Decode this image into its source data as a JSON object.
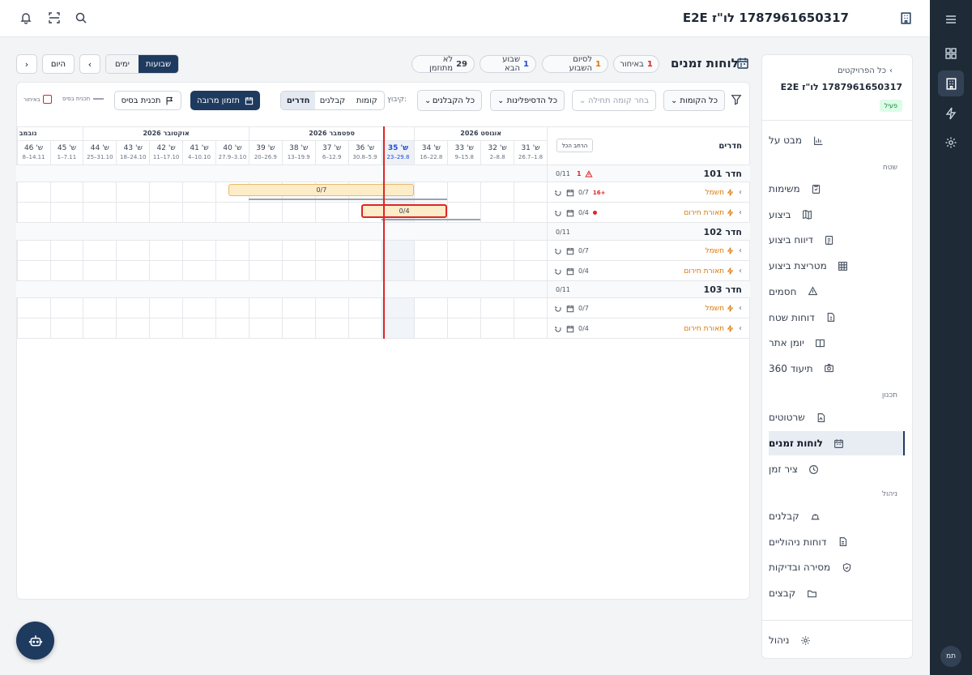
{
  "header": {
    "project_title": "1787961650317 לו\"ז E2E"
  },
  "rail": {
    "avatar": "תמ"
  },
  "sidebar": {
    "back_label": "כל הפרויקטים",
    "project_name": "1787961650317 לו\"ז E2E",
    "status": "פעיל",
    "overview": "מבט על",
    "sections": {
      "field": "שטח",
      "planning": "תכנון",
      "management": "ניהול"
    },
    "field_items": [
      "משימות",
      "ביצוע",
      "דיווח ביצוע",
      "מטריצת ביצוע",
      "חסמים",
      "דוחות שטח",
      "יומן אתר",
      "תיעוד 360"
    ],
    "planning_items": [
      "שרטוטים",
      "לוחות זמנים",
      "ציר זמן"
    ],
    "mgmt_items": [
      "קבלנים",
      "דוחות ניהוליים",
      "מסירה ובדיקות",
      "קבצים"
    ],
    "footer": "ניהול"
  },
  "page": {
    "title": "לוחות זמנים",
    "stats": [
      {
        "value": "1",
        "label": "באיחור",
        "color": "#dc2626"
      },
      {
        "value": "1",
        "label": "לסיום השבוע",
        "color": "#d97706"
      },
      {
        "value": "1",
        "label": "שבוע הבא",
        "color": "#1d4ed8"
      },
      {
        "value": "29",
        "label": "לא מתוזמן",
        "color": "#374151"
      }
    ],
    "view_weeks": "שבועות",
    "view_days": "ימים",
    "today": "היום"
  },
  "filters": {
    "floors": "כל הקומות",
    "start_floor": "בחר קומה תחילה",
    "disciplines": "כל הדסיפלינות",
    "contractors": "כל הקבלנים",
    "group_label": "קיבוץ:",
    "group_options": [
      "קומות",
      "קבלנים",
      "חדרים"
    ],
    "bulk": "תזמון מרובה",
    "baseline": "תכנית בסיס",
    "legend_baseline": "תכנית בסיס",
    "legend_late": "באיחור"
  },
  "gantt": {
    "rooms_header": "חדרים",
    "expand_all": "הרחב הכל",
    "months": [
      "אוגוסט 2026",
      "ספטמבר 2026",
      "אוקטובר 2026",
      "נובמב"
    ],
    "weeks": [
      {
        "w": "ש' 31",
        "d": "26.7–1.8"
      },
      {
        "w": "ש' 32",
        "d": "2–8.8"
      },
      {
        "w": "ש' 33",
        "d": "9–15.8"
      },
      {
        "w": "ש' 34",
        "d": "16–22.8"
      },
      {
        "w": "ש' 35",
        "d": "23–29.8"
      },
      {
        "w": "ש' 36",
        "d": "30.8–5.9"
      },
      {
        "w": "ש' 37",
        "d": "6–12.9"
      },
      {
        "w": "ש' 38",
        "d": "13–19.9"
      },
      {
        "w": "ש' 39",
        "d": "20–26.9"
      },
      {
        "w": "ש' 40",
        "d": "27.9–3.10"
      },
      {
        "w": "ש' 41",
        "d": "4–10.10"
      },
      {
        "w": "ש' 42",
        "d": "11–17.10"
      },
      {
        "w": "ש' 43",
        "d": "18–24.10"
      },
      {
        "w": "ש' 44",
        "d": "25–31.10"
      },
      {
        "w": "ש' 45",
        "d": "1–7.11"
      },
      {
        "w": "ש' 46",
        "d": "8–14.11"
      }
    ],
    "rows": [
      {
        "type": "room",
        "name": "חדר 101",
        "count": "0/11",
        "alert": "1"
      },
      {
        "type": "task",
        "name": "חשמל",
        "count": "0/7",
        "badge": "16+"
      },
      {
        "type": "task",
        "name": "תאורת חירום",
        "count": "0/4",
        "dot": true
      },
      {
        "type": "room",
        "name": "חדר 102",
        "count": "0/11"
      },
      {
        "type": "task",
        "name": "חשמל",
        "count": "0/7"
      },
      {
        "type": "task",
        "name": "תאורת חירום",
        "count": "0/4"
      },
      {
        "type": "room",
        "name": "חדר 103",
        "count": "0/11"
      },
      {
        "type": "task",
        "name": "חשמל",
        "count": "0/7"
      },
      {
        "type": "task",
        "name": "תאורת חירום",
        "count": "0/4"
      }
    ],
    "bars": [
      {
        "label": "0/7"
      },
      {
        "label": "0/4"
      }
    ]
  }
}
